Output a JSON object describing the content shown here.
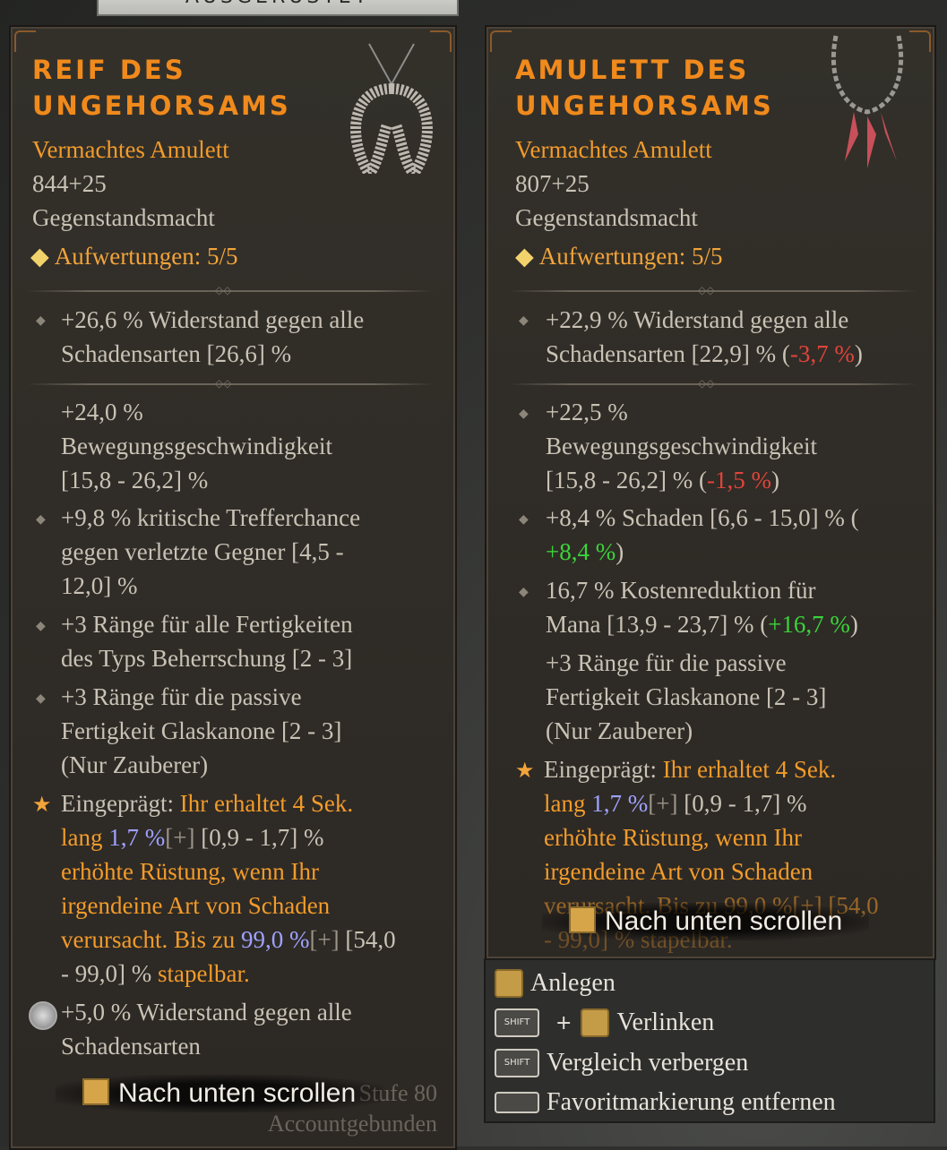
{
  "top_tab": {
    "label": "AUSGERÜSTET"
  },
  "left": {
    "title": "REIF DES\nUNGEHORSAMS",
    "type": "Vermachtes Amulett",
    "power": "844+25",
    "power_label": "Gegenstandsmacht",
    "upgrades": "Aufwertungen: 5/5",
    "implicit": [
      "+26,6 % Widerstand gegen alle",
      "Schadensarten [26,6] %"
    ],
    "affixes": [
      {
        "lines": [
          "+24,0 %",
          "Bewegungsgeschwindigkeit",
          "[15,8 - 26,2] %"
        ]
      },
      {
        "lines": [
          "+9,8 % kritische Trefferchance",
          "gegen verletzte Gegner [4,5 -",
          "12,0] %"
        ]
      },
      {
        "lines": [
          "+3 Ränge für alle Fertigkeiten",
          "des Typs Beherrschung [2 - 3]"
        ]
      },
      {
        "lines": [
          "+3 Ränge für die passive",
          "Fertigkeit Glaskanone [2 - 3]",
          "(Nur Zauberer)"
        ]
      }
    ],
    "aspect": {
      "prefix": "Eingeprägt: ",
      "l1": "Ihr erhaltet 4 Sek.",
      "l2a": "lang ",
      "l2v": "1,7 %",
      "l2p": "[+]",
      "l2r": " [0,9 - 1,7] %",
      "l3": "erhöhte Rüstung, wenn Ihr",
      "l4": "irgendeine Art von Schaden",
      "l5a": "verursacht. Bis zu ",
      "l5v": "99,0 %",
      "l5p": "[+]",
      "l5r": " [54,0",
      "l6a": "- 99,0] % ",
      "l6b": "stapelbar."
    },
    "socket": [
      "+5,0 % Widerstand gegen alle",
      "Schadensarten"
    ],
    "scroll": "Nach unten scrollen",
    "level": "Stufe 80",
    "bound": "Accountgebunden"
  },
  "right": {
    "title": "AMULETT DES\nUNGEHORSAMS",
    "type": "Vermachtes Amulett",
    "power": "807+25",
    "power_label": "Gegenstandsmacht",
    "upgrades": "Aufwertungen: 5/5",
    "implicit": {
      "l1": "+22,9 % Widerstand gegen alle",
      "l2": "Schadensarten [22,9] % (",
      "d": "-3,7 %",
      "e": ")"
    },
    "a1": {
      "l1": "+22,5 %",
      "l2": "Bewegungsgeschwindigkeit",
      "l3": "[15,8 - 26,2] % (",
      "d": "-1,5 %",
      "e": ")"
    },
    "a2": {
      "l1": "+8,4 % Schaden [6,6 - 15,0] % (",
      "d": "+8,4 %",
      "e": ")"
    },
    "a3": {
      "l1": "16,7 % Kostenreduktion für",
      "l2": "Mana [13,9 - 23,7] % (",
      "d": "+16,7 %",
      "e": ")"
    },
    "a4": [
      "+3 Ränge für die passive",
      "Fertigkeit Glaskanone [2 - 3]",
      "(Nur Zauberer)"
    ],
    "aspect": {
      "prefix": "Eingeprägt: ",
      "l1": "Ihr erhaltet 4 Sek.",
      "l2a": "lang ",
      "l2v": "1,7 %",
      "l2p": "[+]",
      "l2r": " [0,9 - 1,7] %",
      "l3": "erhöhte Rüstung, wenn Ihr",
      "l4": "irgendeine Art von Schaden",
      "l5": "verursacht. Bis zu 99,0 %[+] [54,0",
      "l6": "- 99,0] % stapelbar."
    },
    "scroll": "Nach unten scrollen"
  },
  "controls": {
    "equip": "Anlegen",
    "shift": "SHIFT",
    "link": "Verlinken",
    "hide": "Vergleich verbergen",
    "fav": "Favoritmarkierung entfernen"
  },
  "colors": {
    "title": "#f08a1c",
    "rarity": "#f29b2a",
    "negative": "#e0443a",
    "positive": "#3bd43a",
    "value": "#9fa2ff"
  }
}
